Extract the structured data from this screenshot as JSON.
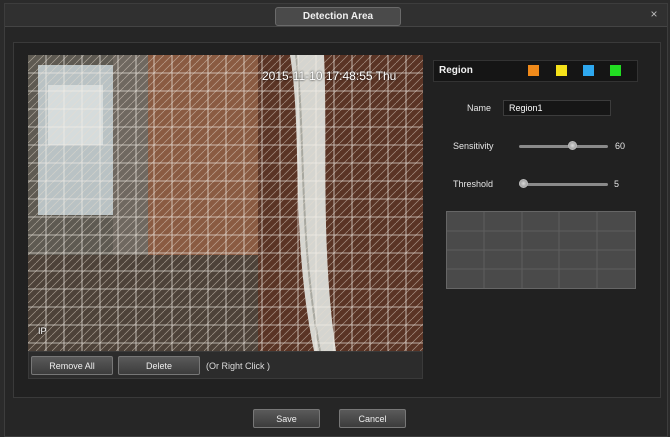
{
  "window": {
    "title": "Detection Area",
    "close_glyph": "×"
  },
  "video": {
    "timestamp": "2015-11-10 17:48:55 Thu",
    "ip_overlay": "IP"
  },
  "video_controls": {
    "remove_all_label": "Remove All",
    "delete_label": "Delete",
    "hint": "(Or Right Click )"
  },
  "region": {
    "label": "Region",
    "colors": [
      {
        "name": "orange",
        "hex": "#f08a1a"
      },
      {
        "name": "yellow",
        "hex": "#f5e21a"
      },
      {
        "name": "blue",
        "hex": "#2ea8ef"
      },
      {
        "name": "green",
        "hex": "#22dd22"
      }
    ]
  },
  "settings": {
    "name_label": "Name",
    "name_value": "Region1",
    "sensitivity_label": "Sensitivity",
    "sensitivity_value": "60",
    "sensitivity_level": 0.6,
    "threshold_label": "Threshold",
    "threshold_value": "5",
    "threshold_level": 0.05
  },
  "footer": {
    "save_label": "Save",
    "cancel_label": "Cancel"
  }
}
